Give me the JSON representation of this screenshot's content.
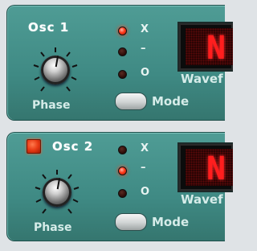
{
  "oscillators": [
    {
      "title": "Osc 1",
      "knob_label": "Phase",
      "mode_label": "Mode",
      "wave_label": "Wavef",
      "display_char": "N",
      "phase_modes": [
        {
          "label": "X",
          "active": true
        },
        {
          "label": "–",
          "active": false
        },
        {
          "label": "O",
          "active": false
        }
      ]
    },
    {
      "title": "Osc 2",
      "knob_label": "Phase",
      "mode_label": "Mode",
      "wave_label": "Wavef",
      "display_char": "N",
      "enabled": true,
      "phase_modes": [
        {
          "label": "X",
          "active": false
        },
        {
          "label": "–",
          "active": true
        },
        {
          "label": "O",
          "active": false
        }
      ]
    }
  ],
  "colors": {
    "panel": "#3f8a84",
    "led_on": "#ff3a1a",
    "display_text": "#ff1e1e"
  }
}
